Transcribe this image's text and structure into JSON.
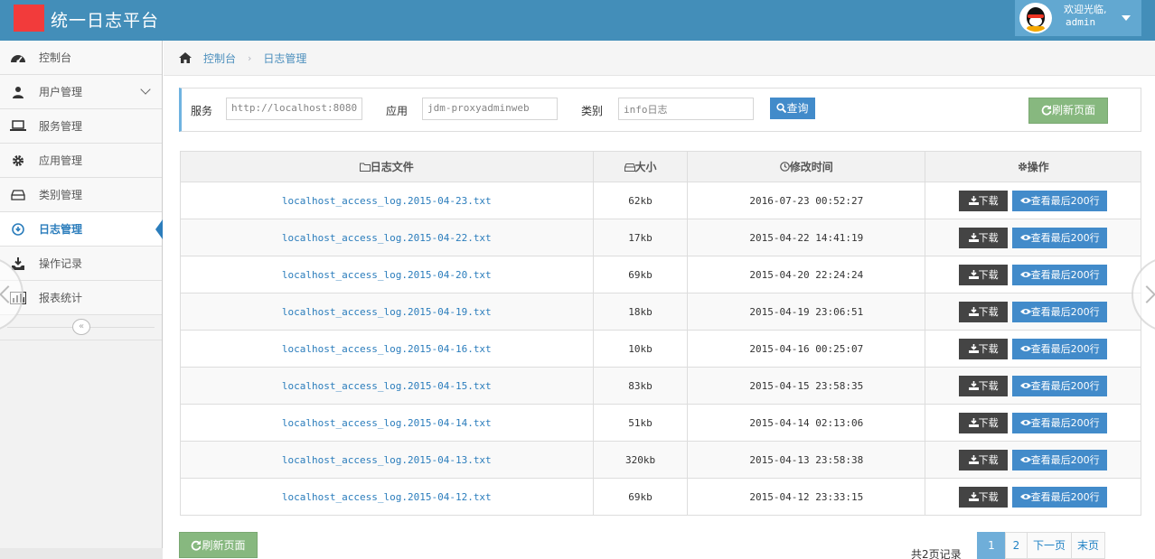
{
  "header": {
    "title": "统一日志平台",
    "user_greeting": "欢迎光临,",
    "user_name": "admin",
    "brand_color": "#438eb9"
  },
  "sidebar": {
    "items": [
      {
        "label": "控制台",
        "icon": "dashboard-icon"
      },
      {
        "label": "用户管理",
        "icon": "user-icon",
        "has_submenu": true
      },
      {
        "label": "服务管理",
        "icon": "laptop-icon"
      },
      {
        "label": "应用管理",
        "icon": "gear-icon"
      },
      {
        "label": "类别管理",
        "icon": "hdd-icon"
      },
      {
        "label": "日志管理",
        "icon": "info-circle-icon",
        "active": true
      },
      {
        "label": "操作记录",
        "icon": "download-tray-icon"
      },
      {
        "label": "报表统计",
        "icon": "bar-chart-icon"
      }
    ],
    "collapse_glyph": "«"
  },
  "breadcrumb": {
    "items": [
      "控制台",
      "日志管理"
    ],
    "separator": "›"
  },
  "filter": {
    "service_label": "服务",
    "service_value": "http://localhost:8080",
    "app_label": "应用",
    "app_value": "jdm-proxyadminweb",
    "category_label": "类别",
    "category_value": "info日志",
    "search_label": "查询",
    "refresh_label": "刷新页面"
  },
  "table": {
    "headers": {
      "file": "日志文件",
      "size": "大小",
      "mtime": "修改时间",
      "actions": "操作"
    },
    "download_label": "下载",
    "view_label": "查看最后200行",
    "rows": [
      {
        "file": "localhost_access_log.2015-04-23.txt",
        "size": "62kb",
        "mtime": "2016-07-23 00:52:27"
      },
      {
        "file": "localhost_access_log.2015-04-22.txt",
        "size": "17kb",
        "mtime": "2015-04-22 14:41:19"
      },
      {
        "file": "localhost_access_log.2015-04-20.txt",
        "size": "69kb",
        "mtime": "2015-04-20 22:24:24"
      },
      {
        "file": "localhost_access_log.2015-04-19.txt",
        "size": "18kb",
        "mtime": "2015-04-19 23:06:51"
      },
      {
        "file": "localhost_access_log.2015-04-16.txt",
        "size": "10kb",
        "mtime": "2015-04-16 00:25:07"
      },
      {
        "file": "localhost_access_log.2015-04-15.txt",
        "size": "83kb",
        "mtime": "2015-04-15 23:58:35"
      },
      {
        "file": "localhost_access_log.2015-04-14.txt",
        "size": "51kb",
        "mtime": "2015-04-14 02:13:06"
      },
      {
        "file": "localhost_access_log.2015-04-13.txt",
        "size": "320kb",
        "mtime": "2015-04-13 23:58:38"
      },
      {
        "file": "localhost_access_log.2015-04-12.txt",
        "size": "69kb",
        "mtime": "2015-04-12 23:33:15"
      }
    ]
  },
  "footer": {
    "refresh_label": "刷新页面",
    "total_text": "共2页记录",
    "pages": [
      "1",
      "2",
      "下一页",
      "末页"
    ],
    "current_page": "1"
  }
}
